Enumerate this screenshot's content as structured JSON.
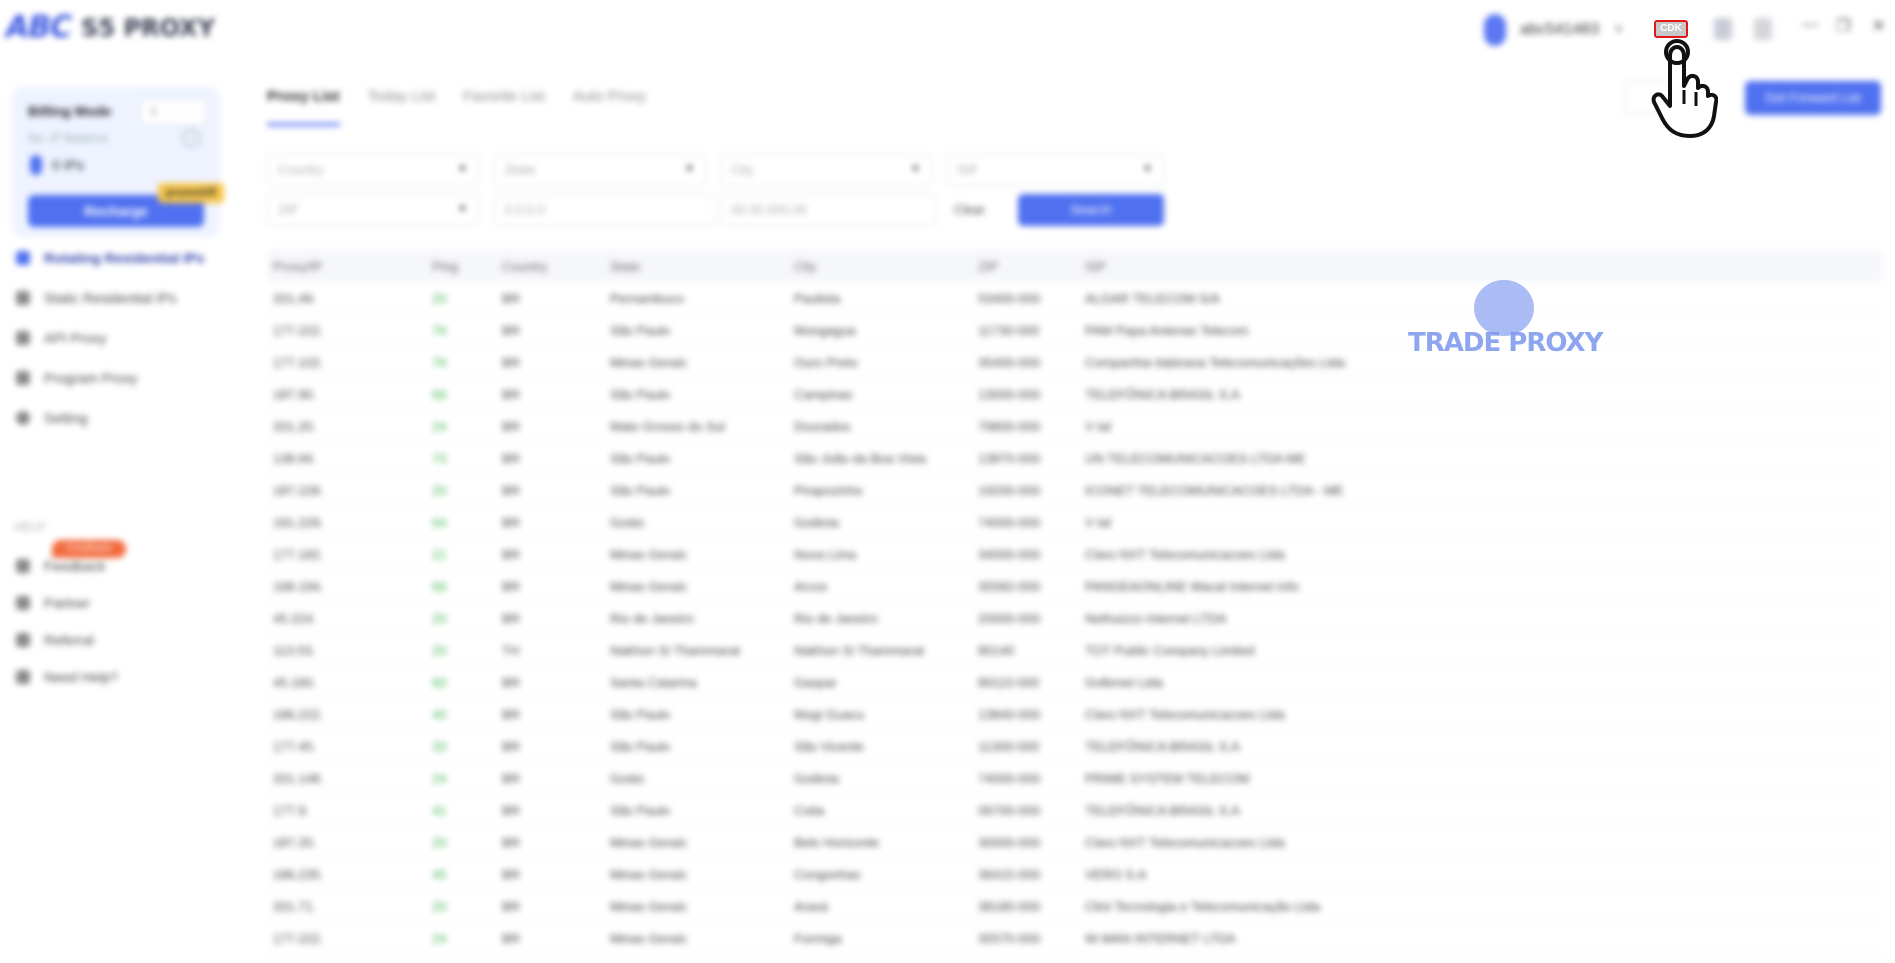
{
  "app": {
    "logo_mark": "ABC",
    "logo_text": "S5 PROXY",
    "user_name": "abc541483",
    "cdk_label": "CDK"
  },
  "sidebar": {
    "billing_title": "Billing Mode",
    "billing_sub": "No. IP Balance",
    "billing_ips": "0 IPs",
    "recharge_label": "Recharge",
    "promo_label": "promoOff",
    "nav": [
      {
        "label": "Rotating Residential IPs",
        "active": true
      },
      {
        "label": "Static Residential IPs",
        "active": false
      },
      {
        "label": "API Proxy",
        "active": false
      },
      {
        "label": "Program Proxy",
        "active": false
      },
      {
        "label": "Setting",
        "active": false
      }
    ],
    "help_label": "HELP",
    "hot_badge": "Feedback",
    "help_items": [
      "Feedback",
      "Partner",
      "Referral",
      "Need Help?"
    ]
  },
  "main": {
    "tabs": [
      "Proxy List",
      "Today List",
      "Favorite List",
      "Auto Proxy"
    ],
    "primary_button": "Get Forward List",
    "filters": {
      "country": "Country",
      "state": "State",
      "city": "City",
      "isp": "ISP",
      "zip": "ZIP",
      "ip_from": "0.0.0.0",
      "ip_to": "00.00.000.00"
    },
    "clear_label": "Clear",
    "search_label": "Search"
  },
  "table": {
    "headers": [
      "Proxy/IP",
      "Ping",
      "Country",
      "State",
      "City",
      "ZIP",
      "ISP"
    ],
    "rows": [
      [
        "201.49.",
        "20",
        "BR",
        "Pernambuco",
        "Paulista",
        "53400-000",
        "ALGAR TELECOM S/A"
      ],
      [
        "177.222.",
        "76",
        "BR",
        "São Paulo",
        "Mongagua",
        "11730-000",
        "PAM Papa Antenas Telecom"
      ],
      [
        "177.102.",
        "76",
        "BR",
        "Minas Gerais",
        "Ouro Preto",
        "35400-000",
        "Companhia Itabirana Telecomunicações Ltda"
      ],
      [
        "187.90.",
        "66",
        "BR",
        "São Paulo",
        "Campinas",
        "13000-000",
        "TELEFÔNICA BRASIL S.A"
      ],
      [
        "201.20.",
        "24",
        "BR",
        "Mato Grosso do Sul",
        "Dourados",
        "79800-000",
        "V tal"
      ],
      [
        "138.94.",
        "73",
        "BR",
        "São Paulo",
        "São João da Boa Vista",
        "13870-000",
        "UN TELECOMUNICACOES LTDA ME"
      ],
      [
        "187.228.",
        "20",
        "BR",
        "São Paulo",
        "Pirapozinho",
        "19200-000",
        "ICONET TELECOMUNICACOES LTDA - ME"
      ],
      [
        "191.229.",
        "64",
        "BR",
        "Goiás",
        "Goiânia",
        "74000-000",
        "V tal"
      ],
      [
        "177.182.",
        "21",
        "BR",
        "Minas Gerais",
        "Nova Lima",
        "34000-000",
        "Claro NXT Telecomunicacoes Ltda"
      ],
      [
        "168.194.",
        "66",
        "BR",
        "Minas Gerais",
        "Arcos",
        "35582-000",
        "PANGEAONLINE Wacal Internet Info"
      ],
      [
        "45.224.",
        "20",
        "BR",
        "Rio de Janeiro",
        "Rio de Janeiro",
        "20000-000",
        "Nethuizzo Internet LTDA"
      ],
      [
        "113.53.",
        "20",
        "TH",
        "Nakhon Si Thammarat",
        "Nakhon Si Thammarat",
        "80140",
        "TOT Public Company Limited"
      ],
      [
        "45.160.",
        "60",
        "BR",
        "Santa Catarina",
        "Gaspar",
        "89110-000",
        "Gvlbrnet Ltda"
      ],
      [
        "186.222.",
        "40",
        "BR",
        "São Paulo",
        "Mogi Guacu",
        "13840-000",
        "Claro NXT Telecomunicacoes Ltda"
      ],
      [
        "177.45.",
        "33",
        "BR",
        "São Paulo",
        "São Vicente",
        "11300-000",
        "TELEFÔNICA BRASIL S.A"
      ],
      [
        "201.148.",
        "24",
        "BR",
        "Goiás",
        "Goiânia",
        "74000-000",
        "PRIME SYSTEM TELECOM"
      ],
      [
        "177.9.",
        "41",
        "BR",
        "São Paulo",
        "Cotia",
        "06700-000",
        "TELEFÔNICA BRASIL S.A"
      ],
      [
        "187.20.",
        "20",
        "BR",
        "Minas Gerais",
        "Belo Horizonte",
        "30000-000",
        "Claro NXT Telecomunicacoes Ltda"
      ],
      [
        "186.235.",
        "45",
        "BR",
        "Minas Gerais",
        "Congonhas",
        "36415-000",
        "VERO S.A"
      ],
      [
        "201.71.",
        "20",
        "BR",
        "Minas Gerais",
        "Araxá",
        "38180-000",
        "Clint Tecnologia e Telecomunicação Ltda"
      ],
      [
        "177.222.",
        "24",
        "BR",
        "Minas Gerais",
        "Formiga",
        "35570-000",
        "W-WAN INTERNET LTDA"
      ]
    ]
  },
  "watermark": {
    "text": "TRADE PROXY"
  },
  "colors": {
    "accent": "#4f70f0",
    "ping_green": "#3ab54a",
    "cdk_border": "#e0181c"
  }
}
